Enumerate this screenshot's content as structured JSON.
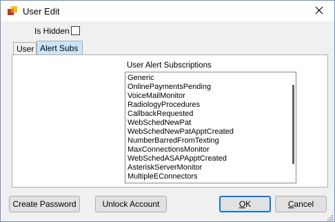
{
  "window": {
    "title": "User Edit",
    "icons": {
      "app": "app-icon",
      "close": "close-icon"
    }
  },
  "is_hidden": {
    "label": "Is Hidden",
    "checked": false
  },
  "tabs": [
    {
      "label": "User",
      "selected": false
    },
    {
      "label": "Alert Subs",
      "selected": true
    }
  ],
  "alert_subs": {
    "list_label": "User Alert Subscriptions",
    "items": [
      "Generic",
      "OnlinePaymentsPending",
      "VoiceMailMonitor",
      "RadiologyProcedures",
      "CallbackRequested",
      "WebSchedNewPat",
      "WebSchedNewPatApptCreated",
      "NumberBarredFromTexting",
      "MaxConnectionsMonitor",
      "WebSchedASAPApptCreated",
      "AsteriskServerMonitor",
      "MultipleEConnectors"
    ]
  },
  "buttons": {
    "create_password": "Create Password",
    "unlock_account": "Unlock Account",
    "ok_mnemonic": "O",
    "ok_rest": "K",
    "cancel_mnemonic": "C",
    "cancel_rest": "ancel"
  },
  "colors": {
    "selected_tab": "#cce4f7",
    "default_button_border": "#0078d7",
    "window_bg": "#f0f0f0"
  }
}
